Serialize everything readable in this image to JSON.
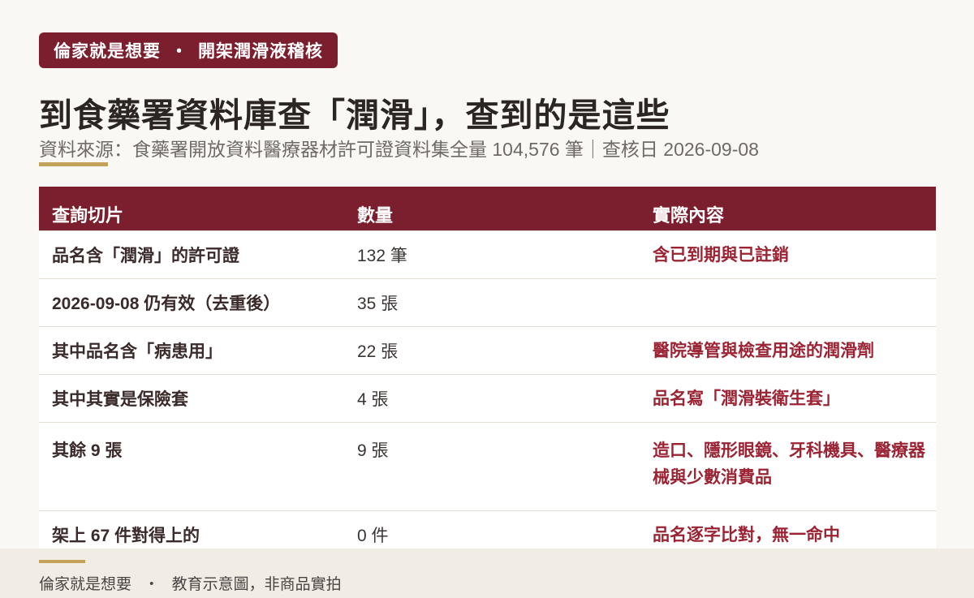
{
  "badge": {
    "brand": "倫家就是想要",
    "separator": "・",
    "section": "開架潤滑液稽核"
  },
  "title": "到食藥署資料庫查「潤滑」，查到的是這些",
  "subtitle": "資料來源：食藥署開放資料醫療器材許可證資料集全量 104,576 筆｜查核日 2026-09-08",
  "table": {
    "headers": [
      "查詢切片",
      "數量",
      "實際內容"
    ],
    "rows": [
      {
        "slice": "品名含「潤滑」的許可證",
        "count": "132 筆",
        "content": "含已到期與已註銷"
      },
      {
        "slice": "2026-09-08 仍有效（去重後）",
        "count": "35 張",
        "content": ""
      },
      {
        "slice": "其中品名含「病患用」",
        "count": "22 張",
        "content": "醫院導管與檢查用途的潤滑劑"
      },
      {
        "slice": "其中其實是保險套",
        "count": "4 張",
        "content": "品名寫「潤滑裝衛生套」"
      },
      {
        "slice": "其餘 9 張",
        "count": "9 張",
        "content": "造口、隱形眼鏡、牙科機具、醫療器械與少數消費品"
      },
      {
        "slice": "架上 67 件對得上的",
        "count": "0 件",
        "content": "品名逐字比對，無一命中"
      }
    ]
  },
  "footer": {
    "brand": "倫家就是想要",
    "separator": "・",
    "note": "教育示意圖，非商品實拍"
  },
  "colors": {
    "accent": "#7b1f2e",
    "gold": "#c5a25a",
    "highlight_text": "#9b2333",
    "background": "#faf8f4"
  }
}
